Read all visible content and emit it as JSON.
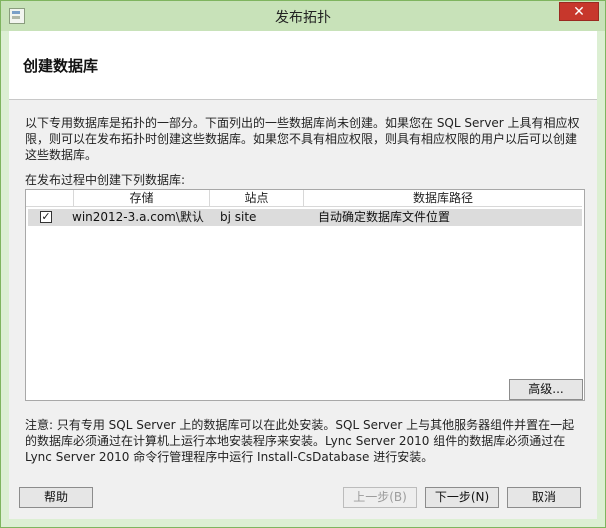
{
  "window": {
    "title": "发布拓扑",
    "close_label": "✕"
  },
  "page": {
    "title": "创建数据库",
    "description": "以下专用数据库是拓扑的一部分。下面列出的一些数据库尚未创建。如果您在 SQL Server 上具有相应权限，则可以在发布拓扑时创建这些数据库。如果您不具有相应权限，则具有相应权限的用户以后可以创建这些数据库。",
    "list_label": "在发布过程中创建下列数据库:"
  },
  "table": {
    "columns": [
      "存储",
      "站点",
      "数据库路径"
    ],
    "rows": [
      {
        "checked": true,
        "check_glyph": "✓",
        "store": "win2012-3.a.com\\默认",
        "site": "bj site",
        "path": "自动确定数据库文件位置"
      }
    ]
  },
  "buttons": {
    "advanced": "高级...",
    "help": "帮助",
    "back": "上一步(B)",
    "next": "下一步(N)",
    "cancel": "取消"
  },
  "note": "注意: 只有专用 SQL Server 上的数据库可以在此处安装。SQL Server 上与其他服务器组件并置在一起的数据库必须通过在计算机上运行本地安装程序来安装。Lync Server 2010 组件的数据库必须通过在 Lync Server 2010 命令行管理程序中运行 Install-CsDatabase 进行安装。"
}
